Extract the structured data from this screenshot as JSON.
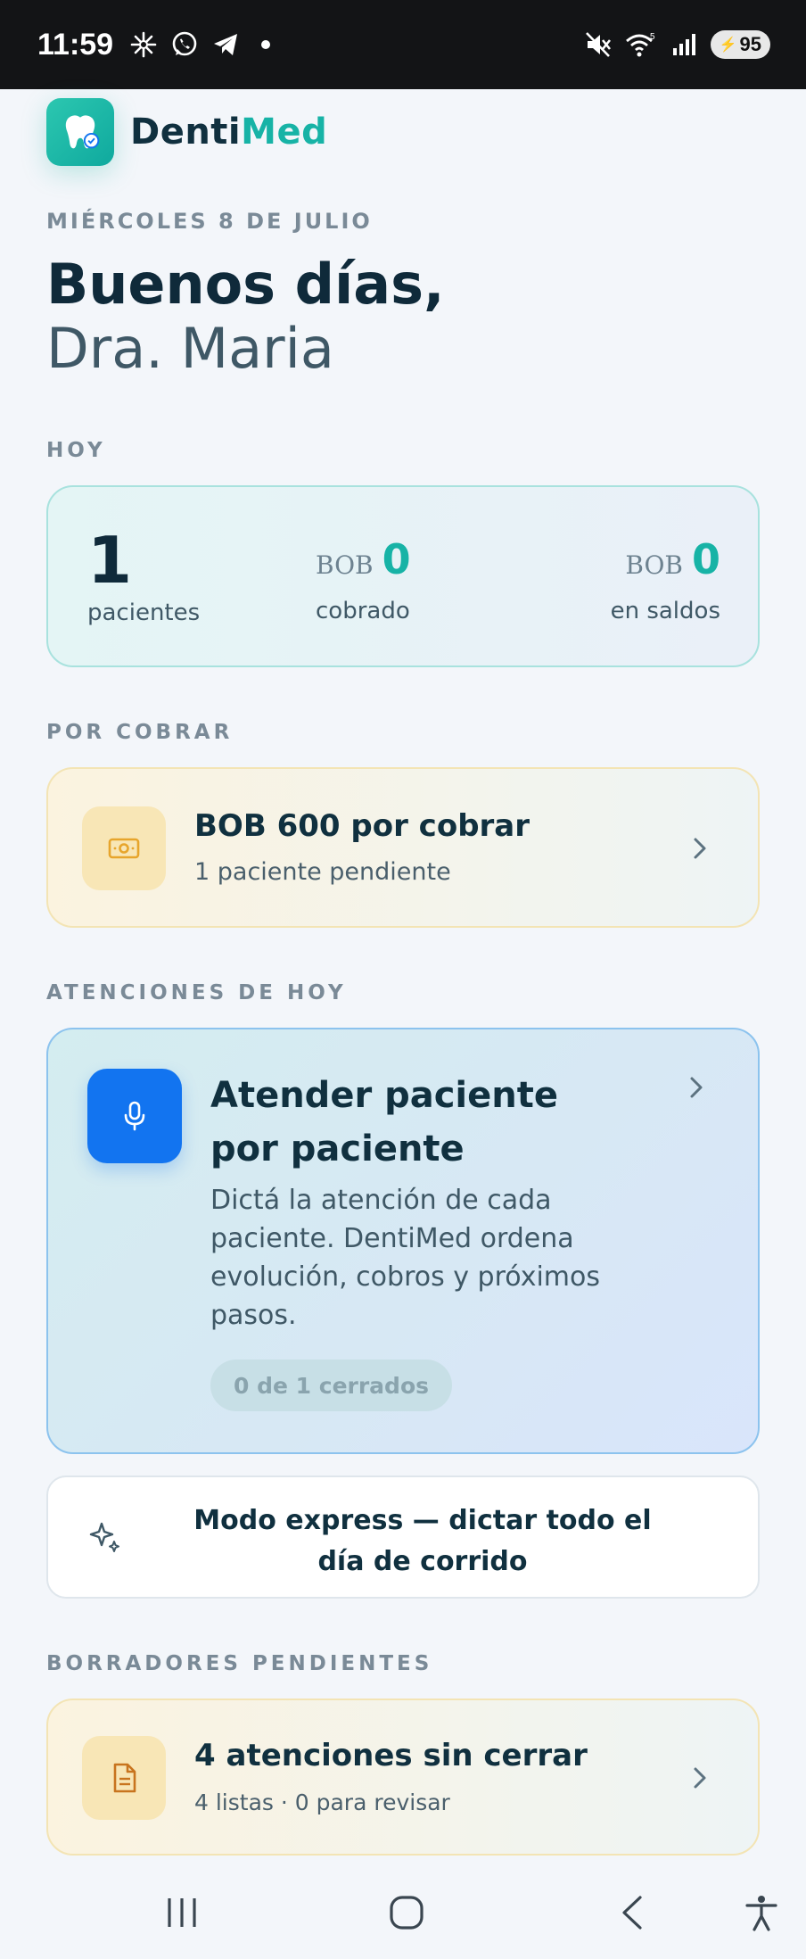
{
  "status_bar": {
    "time": "11:59",
    "battery": "95",
    "icons": [
      "pinwheel-icon",
      "whatsapp-icon",
      "telegram-icon",
      "dot-icon",
      "mute-icon",
      "wifi-icon",
      "signal-icon",
      "battery-icon"
    ]
  },
  "header": {
    "brand_prefix": "Denti",
    "brand_suffix": "Med",
    "logo_icon": "tooth-icon"
  },
  "date_label": "MIÉRCOLES 8 DE JULIO",
  "greeting": {
    "line1": "Buenos días,",
    "line2": "Dra. Maria"
  },
  "today": {
    "section_label": "HOY",
    "patients_value": "1",
    "patients_label": "pacientes",
    "collected_currency": "BOB",
    "collected_value": "0",
    "collected_label": "cobrado",
    "balance_currency": "BOB",
    "balance_value": "0",
    "balance_label": "en saldos"
  },
  "receivables": {
    "section_label": "POR COBRAR",
    "title": "BOB 600 por cobrar",
    "subtitle": "1 paciente pendiente",
    "icon": "cash-icon"
  },
  "attentions": {
    "section_label": "ATENCIONES DE HOY",
    "title": "Atender paciente por paciente",
    "description": "Dictá la atención de cada paciente. DentiMed ordena evolución, cobros y próximos pasos.",
    "progress_label": "0 de 1 cerrados",
    "icon": "microphone-icon"
  },
  "express": {
    "label": "Modo express — dictar todo el día de corrido",
    "icon": "sparkles-icon"
  },
  "drafts": {
    "section_label": "BORRADORES PENDIENTES",
    "title": "4 atenciones sin cerrar",
    "subtitle": "4 listas · 0 para revisar",
    "icon": "document-icon"
  },
  "colors": {
    "accent_teal": "#17b3a6",
    "primary_blue": "#1274f0",
    "amber": "#e7a52c",
    "text_dark": "#10303f"
  }
}
